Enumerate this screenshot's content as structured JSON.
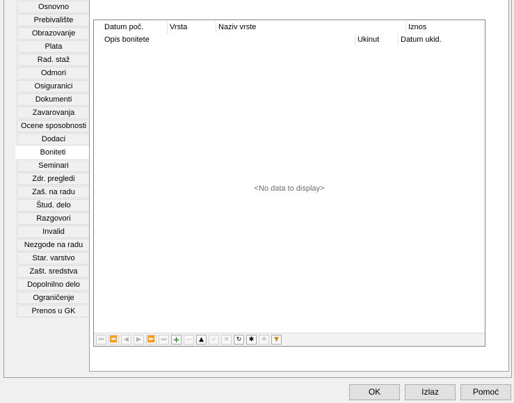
{
  "tabs": [
    "Osnovno",
    "Prebivalište",
    "Obrazovanje",
    "Plata",
    "Rad. staž",
    "Odmori",
    "Osiguranici",
    "Dokumenti",
    "Zavarovanja",
    "Ocene sposobnosti",
    "Dodaci",
    "Boniteti",
    "Seminari",
    "Zdr. pregledi",
    "Zaš. na radu",
    "Štud. delo",
    "Razgovori",
    "Invalid",
    "Nezgode na radu",
    "Star. varstvo",
    "Zašt. sredstva",
    "Dopolnilno delo",
    "Ograničenje",
    "Prenos u GK"
  ],
  "active_tab": "Boniteti",
  "grid": {
    "header_row1": [
      "Datum poč.",
      "Vrsta",
      "Naziv vrste",
      "Iznos"
    ],
    "header_row2": [
      "Opis bonitete",
      "Ukinut",
      "Datum ukid."
    ],
    "empty_text": "<No data to display>"
  },
  "navigator": {
    "buttons": [
      {
        "name": "first-page-icon",
        "glyph": "⏮",
        "enabled": false
      },
      {
        "name": "prev-page-icon",
        "glyph": "⏪",
        "enabled": false
      },
      {
        "name": "prev-record-icon",
        "glyph": "◀",
        "enabled": false
      },
      {
        "name": "next-record-icon",
        "glyph": "▶",
        "enabled": false
      },
      {
        "name": "next-page-icon",
        "glyph": "⏩",
        "enabled": false
      },
      {
        "name": "last-page-icon",
        "glyph": "⏭",
        "enabled": false
      },
      {
        "name": "insert-icon",
        "glyph": "+",
        "enabled": true
      },
      {
        "name": "delete-icon",
        "glyph": "—",
        "enabled": false
      },
      {
        "name": "edit-icon",
        "glyph": "▲",
        "enabled": true
      },
      {
        "name": "post-icon",
        "glyph": "✓",
        "enabled": false
      },
      {
        "name": "cancel-icon",
        "glyph": "✕",
        "enabled": false
      },
      {
        "name": "refresh-icon",
        "glyph": "↻",
        "enabled": true
      },
      {
        "name": "bookmark-icon",
        "glyph": "✱",
        "enabled": true
      },
      {
        "name": "goto-bookmark-icon",
        "glyph": "✲",
        "enabled": false
      },
      {
        "name": "filter-icon",
        "glyph": "▼",
        "enabled": true
      }
    ]
  },
  "buttons": {
    "ok": "OK",
    "exit": "Izlaz",
    "help": "Pomoć"
  },
  "colors": {
    "filter": "#d9860b",
    "insert": "#1b9b1b",
    "border": "#a0a0a0"
  }
}
